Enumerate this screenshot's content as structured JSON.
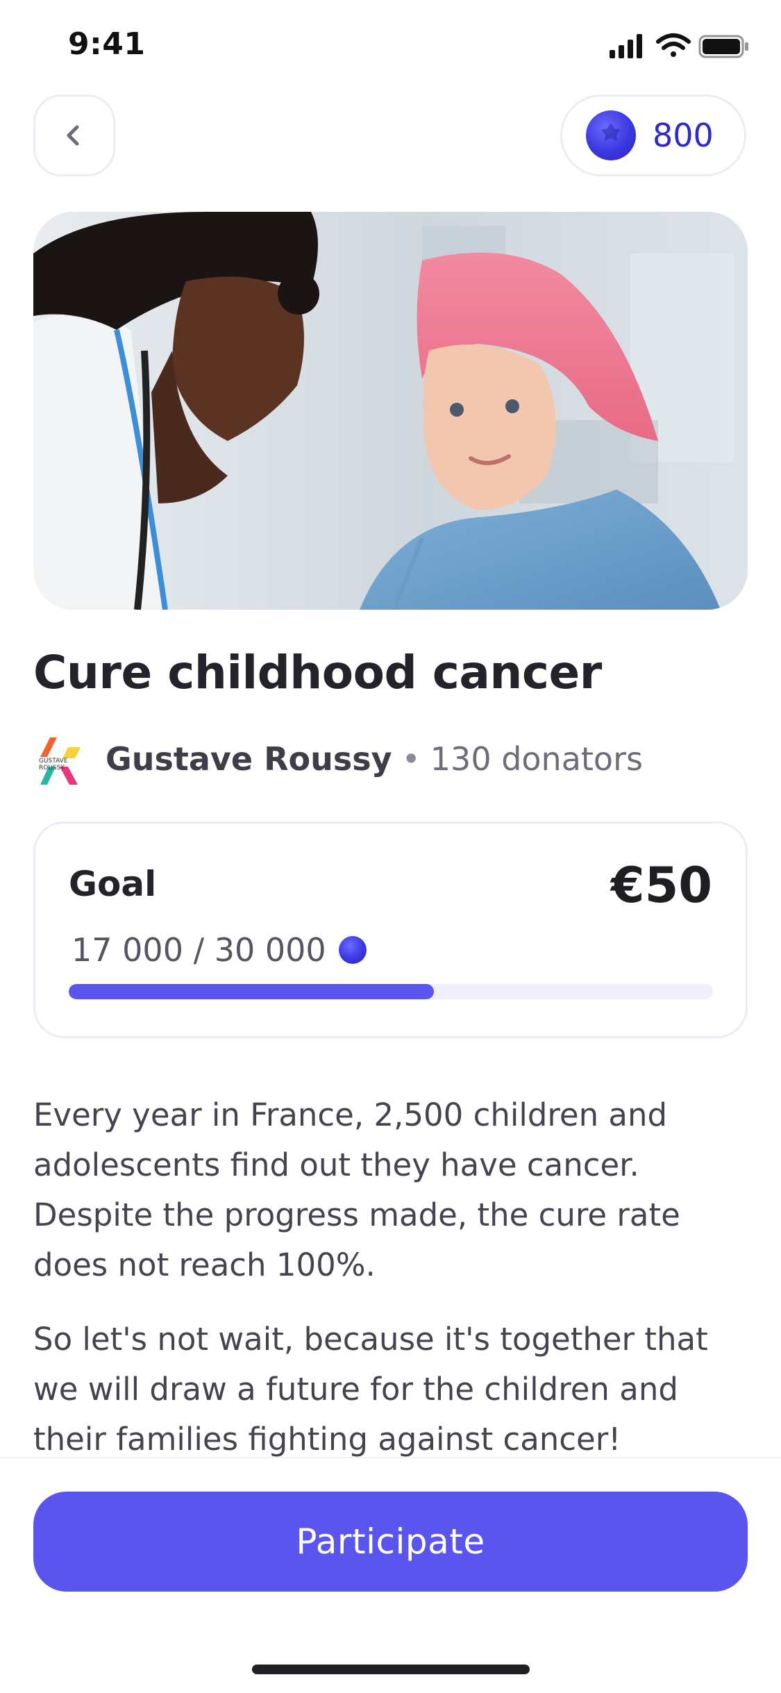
{
  "status_bar": {
    "time": "9:41"
  },
  "header": {
    "balance": "800"
  },
  "campaign": {
    "title": "Cure childhood cancer",
    "organization": "Gustave Roussy",
    "separator": "•",
    "donators": "130 donators",
    "logo_text": [
      "GUSTAVE",
      "ROUSSY"
    ]
  },
  "goal": {
    "label": "Goal",
    "amount": "€50",
    "progress_text": "17 000 / 30 000",
    "progress_fraction": 0.5667
  },
  "description": [
    "Every year in France, 2,500 children and adolescents find out they have cancer. Despite the progress made, the cure rate does not reach 100%.",
    "So let's not wait, because it's together that we will draw a future for the children and their families fighting against cancer!"
  ],
  "cta": {
    "label": "Participate"
  },
  "colors": {
    "accent": "#5b55f0",
    "coin": "#3a37e0",
    "balance_text": "#2e2ac9"
  }
}
